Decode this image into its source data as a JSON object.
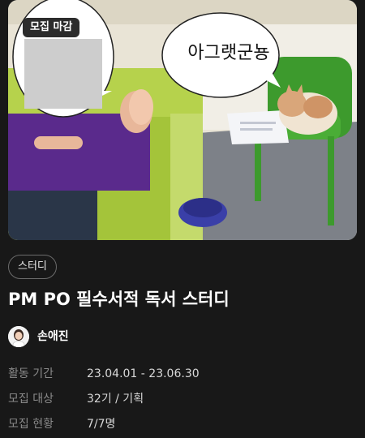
{
  "image": {
    "badge": "모집 마감",
    "speech_text": "아그랫군뇽"
  },
  "tag": "스터디",
  "title": "PM PO 필수서적 독서 스터디",
  "author": {
    "name": "손애진",
    "avatar_icon": "profile-avatar"
  },
  "info": [
    {
      "label": "활동 기간",
      "value": "23.04.01 - 23.06.30"
    },
    {
      "label": "모집 대상",
      "value": "32기 / 기획"
    },
    {
      "label": "모집 현황",
      "value": "7/7명"
    }
  ]
}
